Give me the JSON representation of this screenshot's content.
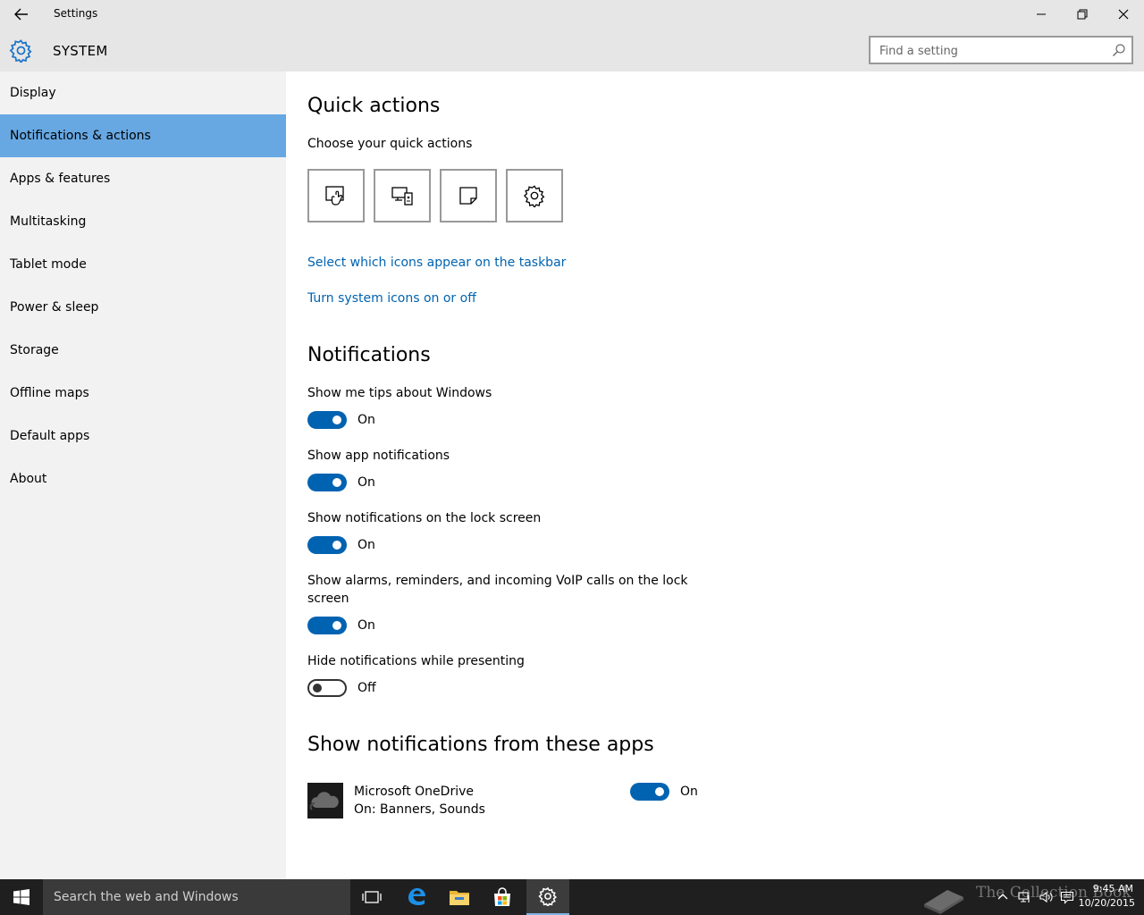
{
  "window": {
    "title": "Settings",
    "controls": [
      "minimize",
      "restore",
      "close"
    ]
  },
  "header": {
    "title": "SYSTEM",
    "icon": "gear-icon",
    "search_placeholder": "Find a setting"
  },
  "sidebar": {
    "items": [
      {
        "label": "Display",
        "active": false
      },
      {
        "label": "Notifications & actions",
        "active": true
      },
      {
        "label": "Apps & features",
        "active": false
      },
      {
        "label": "Multitasking",
        "active": false
      },
      {
        "label": "Tablet mode",
        "active": false
      },
      {
        "label": "Power & sleep",
        "active": false
      },
      {
        "label": "Storage",
        "active": false
      },
      {
        "label": "Offline maps",
        "active": false
      },
      {
        "label": "Default apps",
        "active": false
      },
      {
        "label": "About",
        "active": false
      }
    ]
  },
  "quick_actions": {
    "heading": "Quick actions",
    "subheading": "Choose your quick actions",
    "tiles": [
      "tablet-mode-icon",
      "connect-icon",
      "note-icon",
      "all-settings-icon"
    ],
    "link_taskbar_icons": "Select which icons appear on the taskbar",
    "link_system_icons": "Turn system icons on or off"
  },
  "notifications": {
    "heading": "Notifications",
    "settings": [
      {
        "label": "Show me tips about Windows",
        "state": "On"
      },
      {
        "label": "Show app notifications",
        "state": "On"
      },
      {
        "label": "Show notifications on the lock screen",
        "state": "On"
      },
      {
        "label": "Show alarms, reminders, and incoming VoIP calls on the lock",
        "label2": "screen",
        "state": "On"
      },
      {
        "label": "Hide notifications while presenting",
        "state": "Off"
      }
    ]
  },
  "apps": {
    "heading": "Show notifications from these apps",
    "items": [
      {
        "name": "Microsoft OneDrive",
        "detail": "On: Banners, Sounds",
        "state": "On"
      }
    ]
  },
  "taskbar": {
    "search_placeholder": "Search the web and Windows",
    "time": "9:45 AM",
    "date": "10/20/2015",
    "watermark": "The Collection Book"
  },
  "colors": {
    "accent": "#0063b1",
    "nav_active": "#67a8e3",
    "sidebar_bg": "#f2f2f2",
    "titlebar_bg": "#e6e6e6",
    "taskbar_bg": "#1f1f1f"
  }
}
